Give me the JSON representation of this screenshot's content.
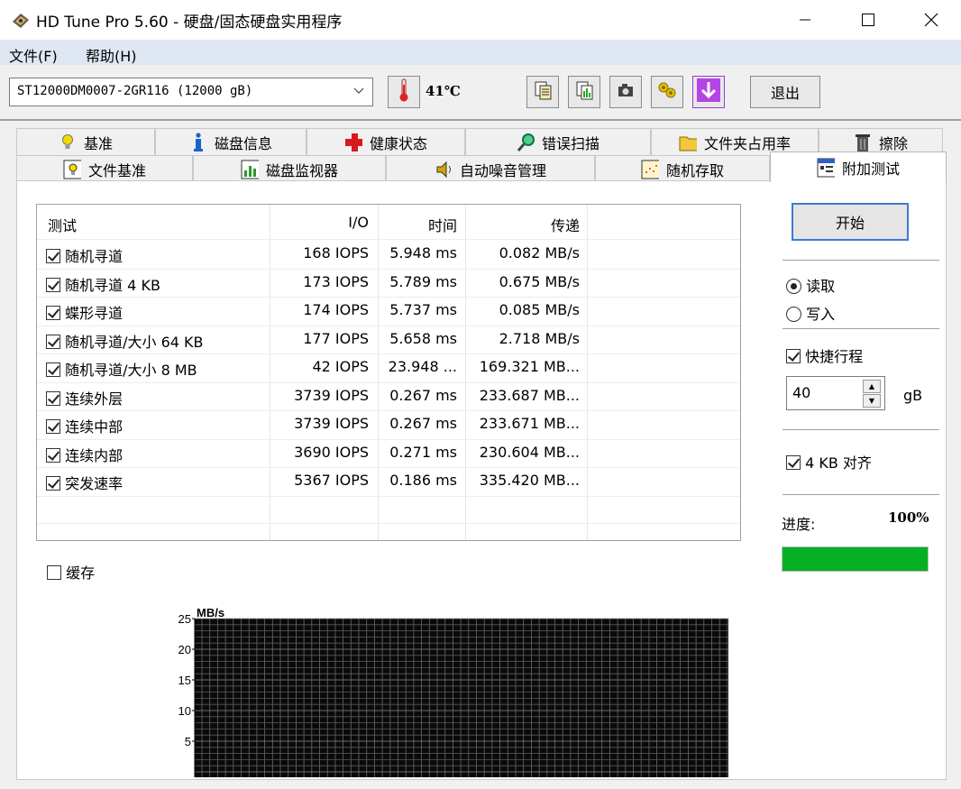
{
  "window": {
    "title": "HD Tune Pro 5.60 - 硬盘/固态硬盘实用程序"
  },
  "menu": {
    "file": "文件(F)",
    "help": "帮助(H)"
  },
  "toolbar": {
    "drive": "ST12000DM0007-2GR116 (12000 gB)",
    "temperature": "41℃",
    "exit_label": "退出",
    "icons": [
      "copy-text-icon",
      "copy-image-icon",
      "camera-icon",
      "options-icon",
      "download-icon"
    ]
  },
  "tabs_row1": [
    {
      "label": "基准",
      "icon": "lightbulb-icon"
    },
    {
      "label": "磁盘信息",
      "icon": "info-icon"
    },
    {
      "label": "健康状态",
      "icon": "health-cross-icon"
    },
    {
      "label": "错误扫描",
      "icon": "magnifier-icon"
    },
    {
      "label": "文件夹占用率",
      "icon": "folder-icon"
    },
    {
      "label": "擦除",
      "icon": "trash-icon"
    }
  ],
  "tabs_row2": [
    {
      "label": "文件基准",
      "icon": "file-benchmark-icon"
    },
    {
      "label": "磁盘监视器",
      "icon": "monitor-chart-icon"
    },
    {
      "label": "自动噪音管理",
      "icon": "speaker-icon"
    },
    {
      "label": "随机存取",
      "icon": "random-access-icon"
    },
    {
      "label": "附加测试",
      "icon": "extra-tests-icon",
      "active": true
    }
  ],
  "table": {
    "headers": [
      "测试",
      "I/O",
      "时间",
      "传递"
    ],
    "rows": [
      {
        "test": "随机寻道",
        "io": "168 IOPS",
        "time": "5.948 ms",
        "transfer": "0.082 MB/s",
        "checked": true
      },
      {
        "test": "随机寻道 4 KB",
        "io": "173 IOPS",
        "time": "5.789 ms",
        "transfer": "0.675 MB/s",
        "checked": true
      },
      {
        "test": "蝶形寻道",
        "io": "174 IOPS",
        "time": "5.737 ms",
        "transfer": "0.085 MB/s",
        "checked": true
      },
      {
        "test": "随机寻道/大小 64 KB",
        "io": "177 IOPS",
        "time": "5.658 ms",
        "transfer": "2.718 MB/s",
        "checked": true
      },
      {
        "test": "随机寻道/大小 8 MB",
        "io": "42 IOPS",
        "time": "23.948 ...",
        "transfer": "169.321 MB...",
        "checked": true
      },
      {
        "test": "连续外层",
        "io": "3739 IOPS",
        "time": "0.267 ms",
        "transfer": "233.687 MB...",
        "checked": true
      },
      {
        "test": "连续中部",
        "io": "3739 IOPS",
        "time": "0.267 ms",
        "transfer": "233.671 MB...",
        "checked": true
      },
      {
        "test": "连续内部",
        "io": "3690 IOPS",
        "time": "0.271 ms",
        "transfer": "230.604 MB...",
        "checked": true
      },
      {
        "test": "突发速率",
        "io": "5367 IOPS",
        "time": "0.186 ms",
        "transfer": "335.420 MB...",
        "checked": true
      }
    ]
  },
  "options": {
    "start_label": "开始",
    "read_label": "读取",
    "write_label": "写入",
    "mode": "read",
    "short_stroke_label": "快捷行程",
    "short_stroke_checked": true,
    "short_stroke_value": "40",
    "short_stroke_unit": "gB",
    "align_label": "4 KB 对齐",
    "align_checked": true,
    "cache_label": "缓存",
    "cache_checked": false,
    "progress_label": "进度:",
    "progress_text": "100%",
    "progress_value": 1.0,
    "progress_color": "#06b025"
  },
  "chart_data": {
    "type": "line",
    "ylabel": "MB/s",
    "ylim": [
      0,
      25
    ],
    "yticks": [
      "25",
      "20",
      "15",
      "10",
      "5"
    ],
    "series": [],
    "grid": true,
    "background": "#0a0a0a"
  }
}
